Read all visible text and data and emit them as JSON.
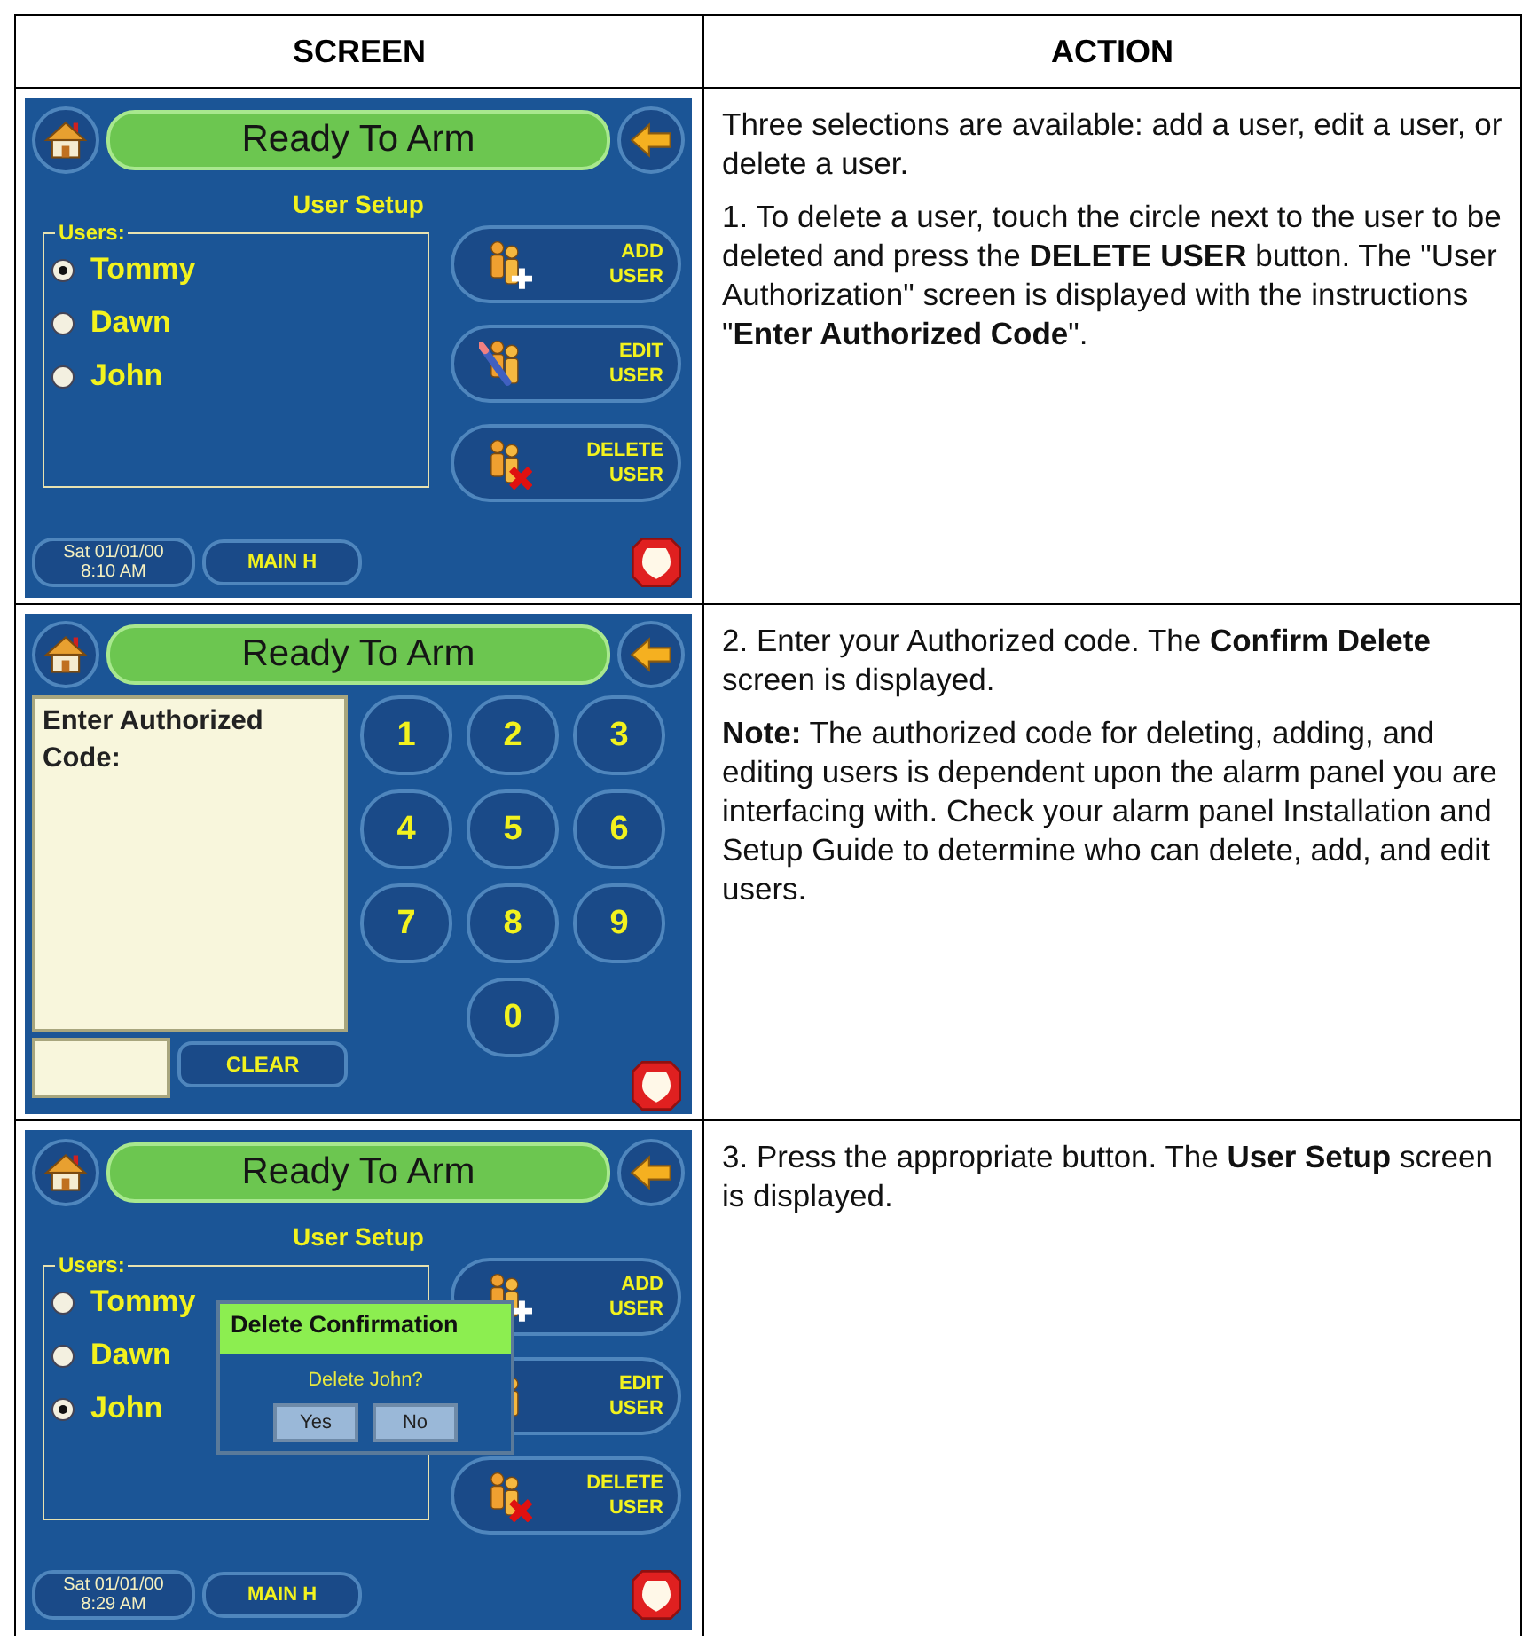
{
  "table": {
    "columns": [
      "SCREEN",
      "ACTION"
    ],
    "rows": [
      {
        "screen": {
          "kind": "user_setup",
          "status": "Ready To Arm",
          "title": "User Setup",
          "group_label": "Users:",
          "users": [
            {
              "name": "Tommy",
              "selected": true
            },
            {
              "name": "Dawn",
              "selected": false
            },
            {
              "name": "John",
              "selected": false
            }
          ],
          "actions": [
            {
              "kind": "add",
              "lines": [
                "ADD",
                "USER"
              ]
            },
            {
              "kind": "edit",
              "lines": [
                "EDIT",
                "USER"
              ]
            },
            {
              "kind": "delete",
              "lines": [
                "DELETE",
                "USER"
              ]
            }
          ],
          "date": "Sat 01/01/00",
          "time": "8:10 AM",
          "mode_button": "MAIN H"
        },
        "action": [
          "Three selections are available: add a user, edit a user, or delete a user.",
          "1.  To delete a user, touch the circle next to the user to be deleted and press the **DELETE USER** button.  The \"User Authorization\" screen is displayed with the instructions \"**Enter Authorized Code**\"."
        ]
      },
      {
        "screen": {
          "kind": "keypad",
          "status": "Ready To Arm",
          "prompt": "Enter Authorized Code:",
          "keys": [
            "1",
            "2",
            "3",
            "4",
            "5",
            "6",
            "7",
            "8",
            "9",
            "0"
          ],
          "clear_button": "CLEAR"
        },
        "action": [
          "2.  Enter your Authorized code.  The **Confirm Delete** screen is displayed.",
          "**Note:** The authorized code for deleting, adding, and editing users is dependent upon the alarm panel you are interfacing with. Check your alarm panel Installation and Setup Guide to determine who can delete, add, and edit users."
        ]
      },
      {
        "screen": {
          "kind": "user_setup",
          "status": "Ready To Arm",
          "title": "User Setup",
          "group_label": "Users:",
          "users": [
            {
              "name": "Tommy",
              "selected": false
            },
            {
              "name": "Dawn",
              "selected": false
            },
            {
              "name": "John",
              "selected": true
            }
          ],
          "actions": [
            {
              "kind": "add",
              "lines": [
                "ADD",
                "USER"
              ]
            },
            {
              "kind": "edit",
              "lines": [
                "EDIT",
                "USER"
              ]
            },
            {
              "kind": "delete",
              "lines": [
                "DELETE",
                "USER"
              ]
            }
          ],
          "date": "Sat 01/01/00",
          "time": "8:29 AM",
          "mode_button": "MAIN H",
          "dialog": {
            "title": "Delete Confirmation",
            "message": "Delete John?",
            "buttons": [
              "Yes",
              "No"
            ]
          }
        },
        "action": [
          "3.  Press the appropriate button.  The **User Setup** screen is displayed."
        ]
      }
    ]
  }
}
